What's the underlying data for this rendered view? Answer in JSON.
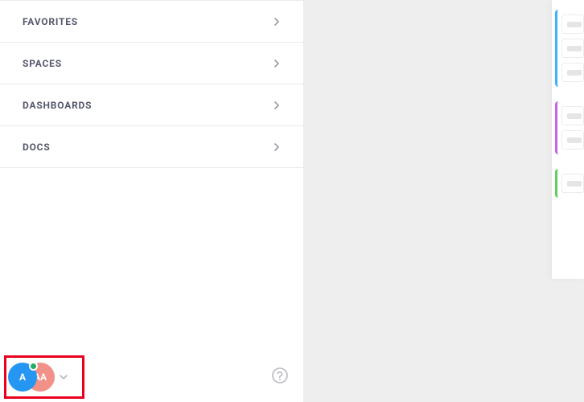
{
  "sidebar": {
    "items": [
      {
        "label": "FAVORITES"
      },
      {
        "label": "SPACES"
      },
      {
        "label": "DASHBOARDS"
      },
      {
        "label": "DOCS"
      }
    ]
  },
  "footer": {
    "avatar_primary_initial": "A",
    "avatar_secondary_initial": "AA",
    "presence_color": "#27ae60"
  },
  "panel": {
    "groups": [
      {
        "color": "#3fb0ff",
        "cards": 3
      },
      {
        "color": "#c565e6",
        "cards": 2
      },
      {
        "color": "#5fcf5f",
        "cards": 1
      }
    ]
  }
}
